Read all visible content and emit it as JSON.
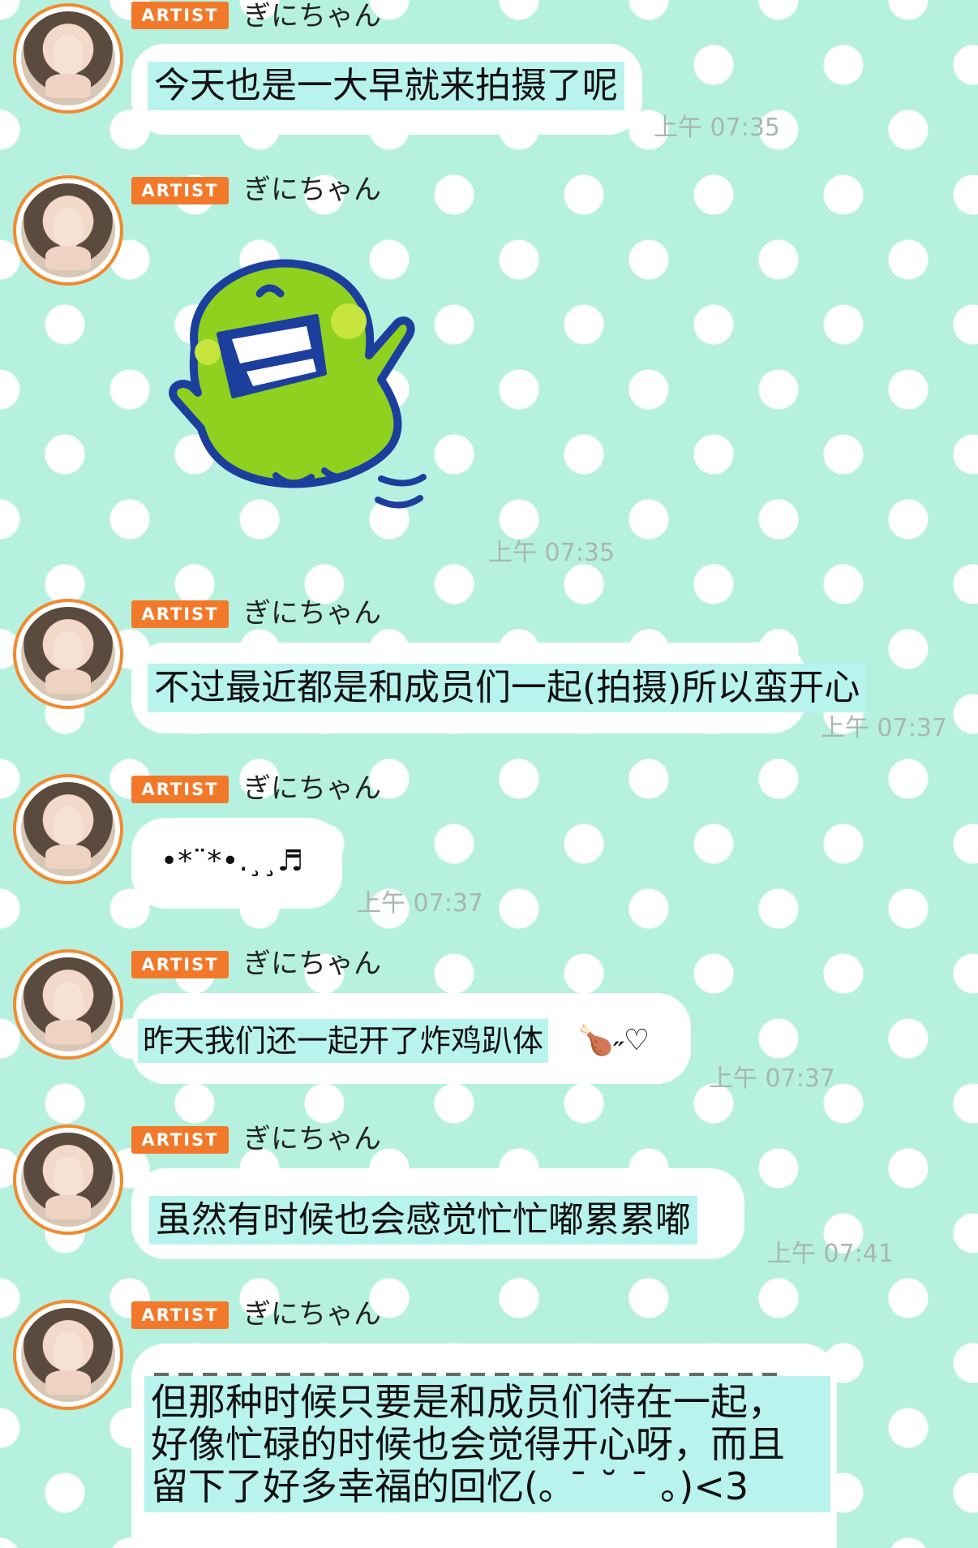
{
  "artist_badge": "ARTIST",
  "sender_name": "ぎにちゃん",
  "messages": [
    {
      "type": "text",
      "text": "今天也是一大早就来拍摄了呢",
      "time": "上午 07:35"
    },
    {
      "type": "sticker",
      "sticker": "green-tamagotchi-character-sticker",
      "time": "上午 07:35"
    },
    {
      "type": "text",
      "text": "不过最近都是和成员们一起(拍摄)所以蛮开心",
      "time": "上午 07:37"
    },
    {
      "type": "text",
      "text": "•*¨*•.¸¸♬",
      "time": "上午 07:37"
    },
    {
      "type": "text",
      "text": "昨天我们还一起开了炸鸡趴体",
      "emoji_suffix": "🍗˶♡",
      "time": "上午 07:37"
    },
    {
      "type": "text",
      "text": "虽然有时候也会感觉忙忙嘟累累嘟",
      "time": "上午 07:41"
    },
    {
      "type": "text",
      "lines": [
        "但那种时候只要是和成员们待在一起，",
        "好像忙碌的时候也会觉得开心呀，而且",
        "留下了好多幸福的回忆(｡ ¯ ˘ ¯ ｡)<3"
      ]
    }
  ],
  "colors": {
    "background": "#b6f1df",
    "badge": "#f2792a",
    "avatar_ring": "#f28a2e",
    "highlight": "#b9f3ee",
    "sticker_body": "#8fd11f",
    "sticker_outline": "#1c3f9e"
  }
}
